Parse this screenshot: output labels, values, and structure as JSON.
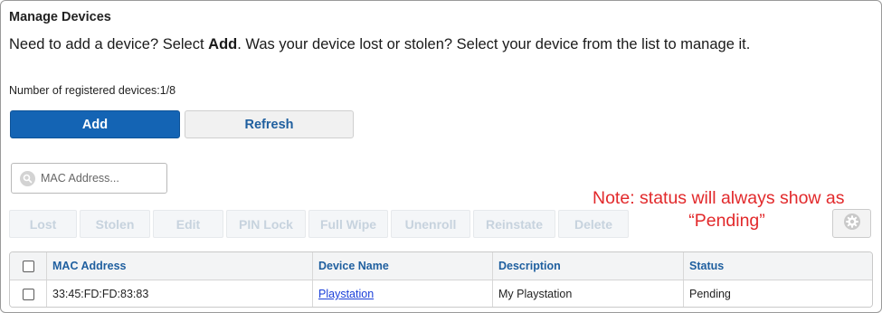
{
  "page": {
    "title": "Manage Devices",
    "intro": {
      "part1": "Need to add a device? Select ",
      "bold": "Add",
      "part2": ". Was your device lost or stolen? Select your device from the list to manage it."
    },
    "registered_count": "Number of registered devices:1/8"
  },
  "buttons": {
    "add": "Add",
    "refresh": "Refresh"
  },
  "search": {
    "placeholder": "MAC Address...",
    "value": ""
  },
  "actions": [
    {
      "label": "Lost",
      "w": 75
    },
    {
      "label": "Stolen",
      "w": 78
    },
    {
      "label": "Edit",
      "w": 78
    },
    {
      "label": "PIN Lock",
      "w": 88
    },
    {
      "label": "Full Wipe",
      "w": 88
    },
    {
      "label": "Unenroll",
      "w": 88
    },
    {
      "label": "Reinstate",
      "w": 91
    },
    {
      "label": "Delete",
      "w": 78
    }
  ],
  "note": {
    "line1": "Note: status will always show as",
    "line2": "“Pending”"
  },
  "table": {
    "headers": [
      "MAC Address",
      "Device Name",
      "Description",
      "Status"
    ],
    "rows": [
      {
        "mac": "33:45:FD:FD:83:83",
        "device_name": "Playstation",
        "description": "My Playstation",
        "status": "Pending"
      }
    ]
  },
  "colors": {
    "primary": "#1464b4",
    "header_text": "#1f5f9f",
    "note": "#e2292b",
    "link": "#1a3fd9"
  },
  "icons": {
    "search": "search-icon",
    "settings": "gear-icon"
  }
}
